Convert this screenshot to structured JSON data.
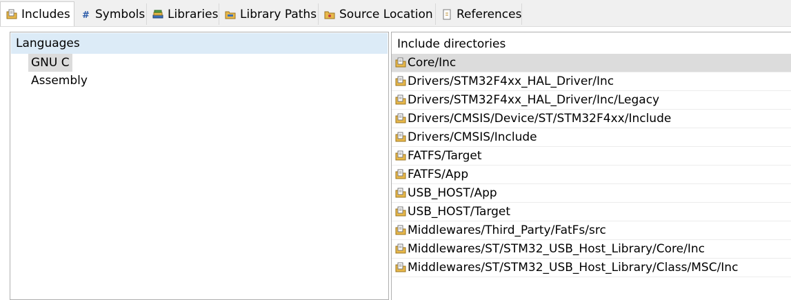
{
  "tabs": [
    {
      "label": "Includes",
      "icon": "include-folder-icon",
      "active": true
    },
    {
      "label": "Symbols",
      "icon": "hash-icon",
      "active": false
    },
    {
      "label": "Libraries",
      "icon": "library-books-icon",
      "active": false
    },
    {
      "label": "Library Paths",
      "icon": "library-folder-icon",
      "active": false
    },
    {
      "label": "Source Location",
      "icon": "source-folder-icon",
      "active": false
    },
    {
      "label": "References",
      "icon": "references-doc-icon",
      "active": false
    }
  ],
  "languages": {
    "header": "Languages",
    "items": [
      "GNU C",
      "Assembly"
    ],
    "selected": "GNU C"
  },
  "include_directories": {
    "header": "Include directories",
    "selected": "Core/Inc",
    "items": [
      "Core/Inc",
      "Drivers/STM32F4xx_HAL_Driver/Inc",
      "Drivers/STM32F4xx_HAL_Driver/Inc/Legacy",
      "Drivers/CMSIS/Device/ST/STM32F4xx/Include",
      "Drivers/CMSIS/Include",
      "FATFS/Target",
      "FATFS/App",
      "USB_HOST/App",
      "USB_HOST/Target",
      "Middlewares/Third_Party/FatFs/src",
      "Middlewares/ST/STM32_USB_Host_Library/Core/Inc",
      "Middlewares/ST/STM32_USB_Host_Library/Class/MSC/Inc"
    ]
  },
  "colors": {
    "tabbar_bg": "#f0f0f0",
    "header_highlight": "#dcebf7",
    "selection": "#dcdcdc",
    "folder_yellow": "#e8b84a"
  }
}
